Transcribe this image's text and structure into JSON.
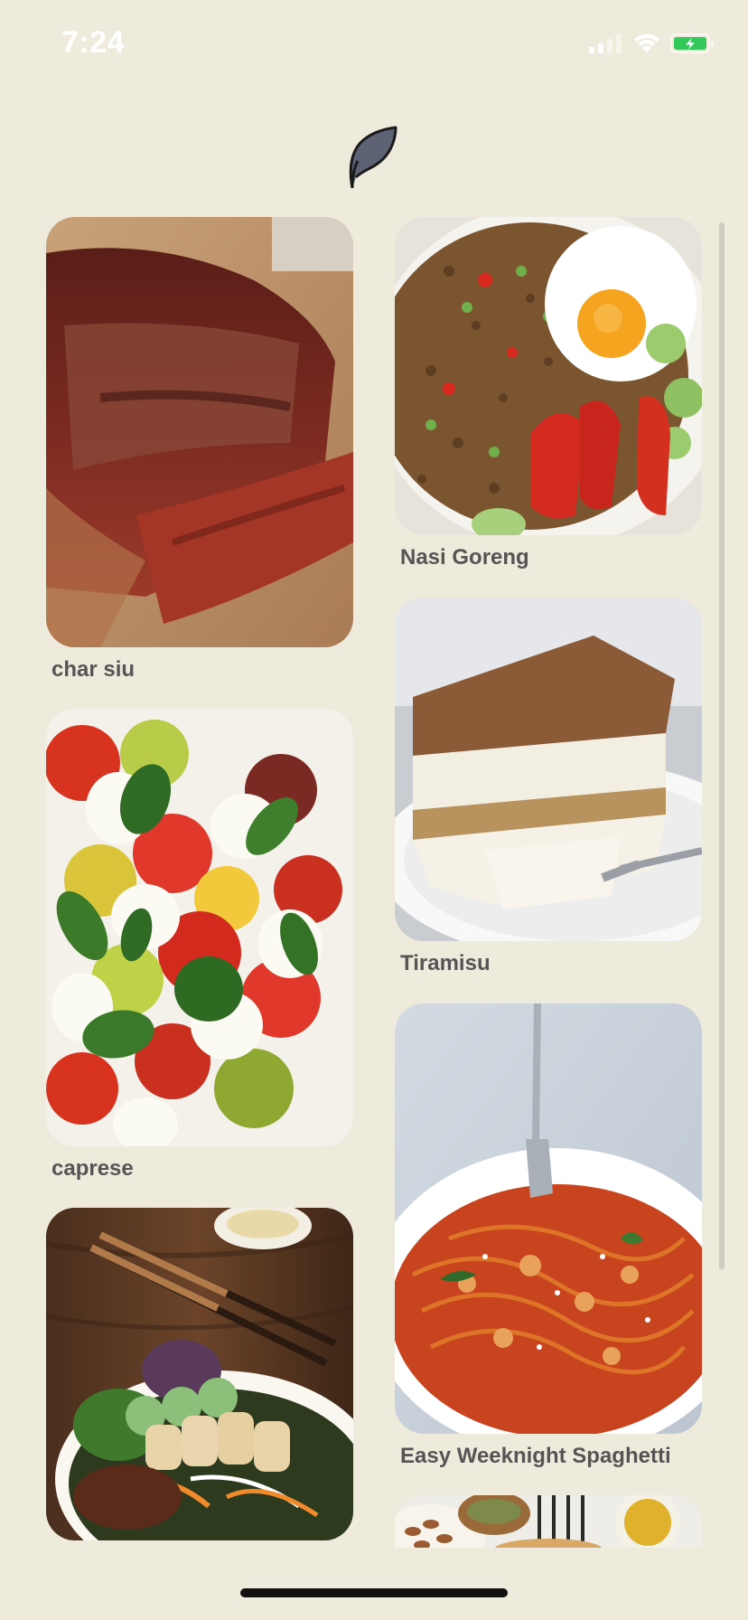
{
  "status_bar": {
    "time": "7:24",
    "icons": [
      "cellular-signal-icon",
      "wifi-icon",
      "battery-charging-icon"
    ],
    "battery_color": "#34C759"
  },
  "header": {
    "logo_icon": "leaf-logo-icon"
  },
  "recipes": [
    {
      "title": "char siu",
      "image": "char-siu-photo"
    },
    {
      "title": "caprese",
      "image": "caprese-photo"
    },
    {
      "title": "",
      "image": "spring-roll-bowl-photo"
    },
    {
      "title": "Nasi Goreng",
      "image": "nasi-goreng-photo"
    },
    {
      "title": "Tiramisu",
      "image": "tiramisu-photo"
    },
    {
      "title": "Easy Weeknight Spaghetti",
      "image": "spaghetti-photo"
    },
    {
      "title": "",
      "image": "almonds-and-oil-photo"
    }
  ],
  "colors": {
    "background": "#EFEBDC",
    "title_text": "#555555"
  }
}
